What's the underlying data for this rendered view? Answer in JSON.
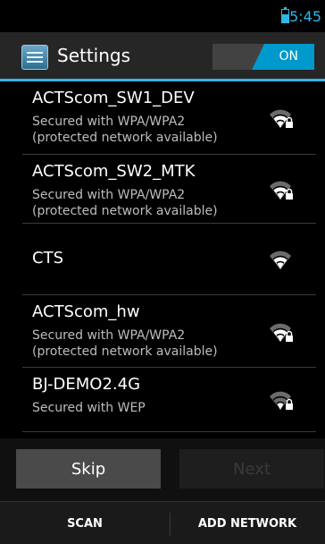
{
  "status_bar": {
    "time": "5:45"
  },
  "action_bar": {
    "title": "Settings",
    "wifi_toggle": "ON"
  },
  "networks": [
    {
      "name": "ACTScom_SW1_DEV",
      "summary": "Secured with WPA/WPA2\n(protected network available)",
      "secured": true,
      "signal_level": 3
    },
    {
      "name": "ACTScom_SW2_MTK",
      "summary": "Secured with WPA/WPA2\n(protected network available)",
      "secured": true,
      "signal_level": 3
    },
    {
      "name": "CTS",
      "summary": "",
      "secured": false,
      "signal_level": 3
    },
    {
      "name": "ACTScom_hw",
      "summary": "Secured with WPA/WPA2\n(protected network available)",
      "secured": true,
      "signal_level": 3
    },
    {
      "name": "BJ-DEMO2.4G",
      "summary": "Secured with WEP",
      "secured": true,
      "signal_level": 2
    }
  ],
  "buttons": {
    "skip": "Skip",
    "next": "Next"
  },
  "bottom_bar": {
    "scan": "SCAN",
    "add_network": "ADD NETWORK"
  },
  "colors": {
    "accent": "#33b5e5",
    "toggle_on": "#0099cc"
  },
  "icons": {
    "battery": "battery-icon",
    "app": "settings-app-icon",
    "signal": "wifi-signal-icon",
    "lock": "lock-icon"
  }
}
